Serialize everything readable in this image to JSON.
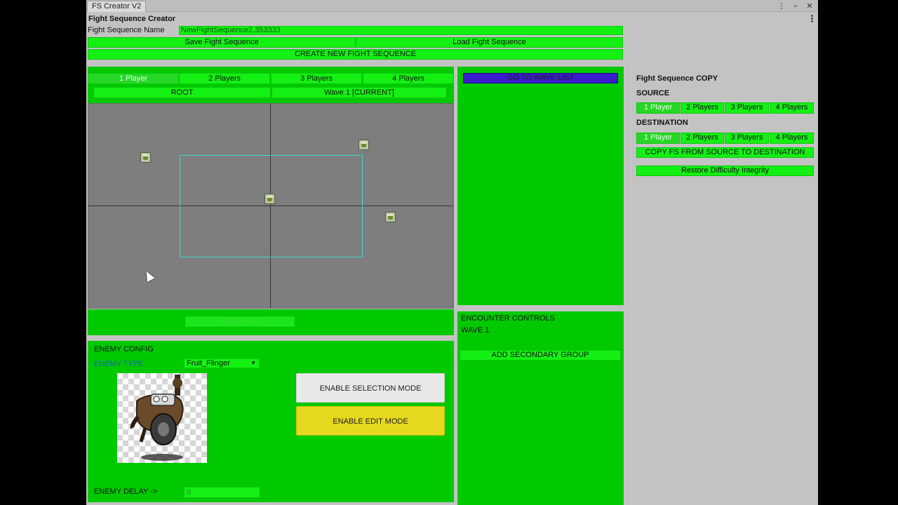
{
  "window": {
    "tab_title": "FS Creator V2",
    "controls": {
      "menu_icon": "⋮",
      "maximize_icon": "▫",
      "close_icon": "✕"
    }
  },
  "header": {
    "title": "Fight Sequence Creator",
    "name_label": "Fight Sequence Name",
    "name_value": "NewFightSequence2.353333",
    "save_label": "Save Fight Sequence",
    "load_label": "Load Fight Sequence",
    "create_label": "CREATE NEW FIGHT SEQUENCE"
  },
  "player_tabs": [
    "1 Player",
    "2 Players",
    "3 Players",
    "4 Players"
  ],
  "wave_nav": {
    "root_label": "ROOT",
    "wave_label": "Wave 1 [CURRENT]"
  },
  "selected_enemy_label": "Fruit_Flinger",
  "go_to_wave_list_label": "GO TO WAVE LIST",
  "enemy_config": {
    "title": "ENEMY CONFIG",
    "type_label": "ENEMY TYPE",
    "type_value": "Fruit_Flinger",
    "selection_mode_label": "ENABLE SELECTION MODE",
    "edit_mode_label": "ENABLE EDIT MODE",
    "delay_label": "ENEMY DELAY ->",
    "delay_value": "0"
  },
  "encounter": {
    "title": "ENCOUNTER  CONTROLS",
    "wave_label": "WAVE 1",
    "add_group_label": "ADD SECONDARY GROUP"
  },
  "copy_panel": {
    "title": "Fight Sequence COPY",
    "source_label": "SOURCE",
    "destination_label": "DESTINATION",
    "source_tabs": [
      "1 Player",
      "2 Players",
      "3 Players",
      "4 Players"
    ],
    "destination_tabs": [
      "1 Player",
      "2 Players",
      "3 Players",
      "4 Players"
    ],
    "copy_label": "COPY FS FROM SOURCE TO DESTINATION",
    "restore_label": "Restore Difficulty Integrity"
  },
  "colors": {
    "panel_green": "#00c900",
    "button_green": "#14f014",
    "wave_list_button": "#3a1ccc",
    "edit_mode_yellow": "#e6d81e",
    "selection_mode_gray": "#e8e8e8",
    "view_gray": "#7e7e7e"
  }
}
